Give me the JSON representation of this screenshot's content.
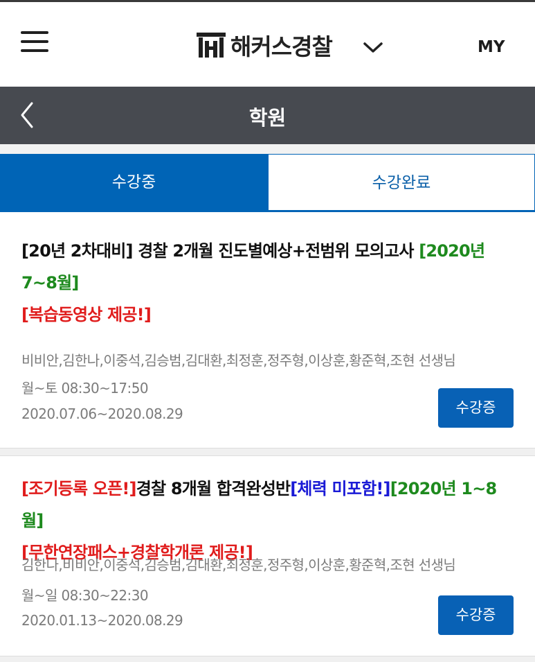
{
  "header": {
    "brand": "해커스경찰",
    "my_label": "MY"
  },
  "subheader": {
    "title": "학원"
  },
  "tabs": [
    {
      "label": "수강중",
      "active": true
    },
    {
      "label": "수강완료",
      "active": false
    }
  ],
  "courses": [
    {
      "title_parts": [
        {
          "text": "[20년 2차대비] 경찰 2개월 진도별예상+전범위 모의고사 ",
          "color": "black"
        },
        {
          "text": "[2020년 7~8월]",
          "color": "green"
        }
      ],
      "title_line2": {
        "text": "[복습동영상 제공!]",
        "color": "red"
      },
      "teachers": "비비안,김한나,이중석,김승범,김대환,최정훈,정주형,이상훈,황준혁,조현 선생님",
      "schedule": "월~토 08:30~17:50",
      "period": "2020.07.06~2020.08.29",
      "button": "수강증"
    },
    {
      "title_parts": [
        {
          "text": "[조기등록 오픈!]",
          "color": "red"
        },
        {
          "text": "경찰 8개월 합격완성반",
          "color": "black"
        },
        {
          "text": "[체력 미포함!]",
          "color": "blue"
        },
        {
          "text": "[2020년 1~8월]",
          "color": "green"
        }
      ],
      "title_line2": {
        "text": "[무한연장패스+경찰학개론 제공!]",
        "color": "red"
      },
      "teachers": "김한나,비비안,이중석,김승범,김대환,최정훈,정주형,이상훈,황준혁,조현 선생님",
      "schedule": "월~일 08:30~22:30",
      "period": "2020.01.13~2020.08.29",
      "button": "수강증"
    }
  ],
  "colors": {
    "accent": "#0064b6",
    "subheader_bg": "#474a50",
    "green": "#1e8a1e",
    "red": "#e01c1c",
    "blue": "#1a1ad6"
  },
  "icons": {
    "menu": "hamburger-icon",
    "dropdown": "chevron-down-icon",
    "back": "chevron-left-icon",
    "logo": "pillar-logo-icon"
  }
}
